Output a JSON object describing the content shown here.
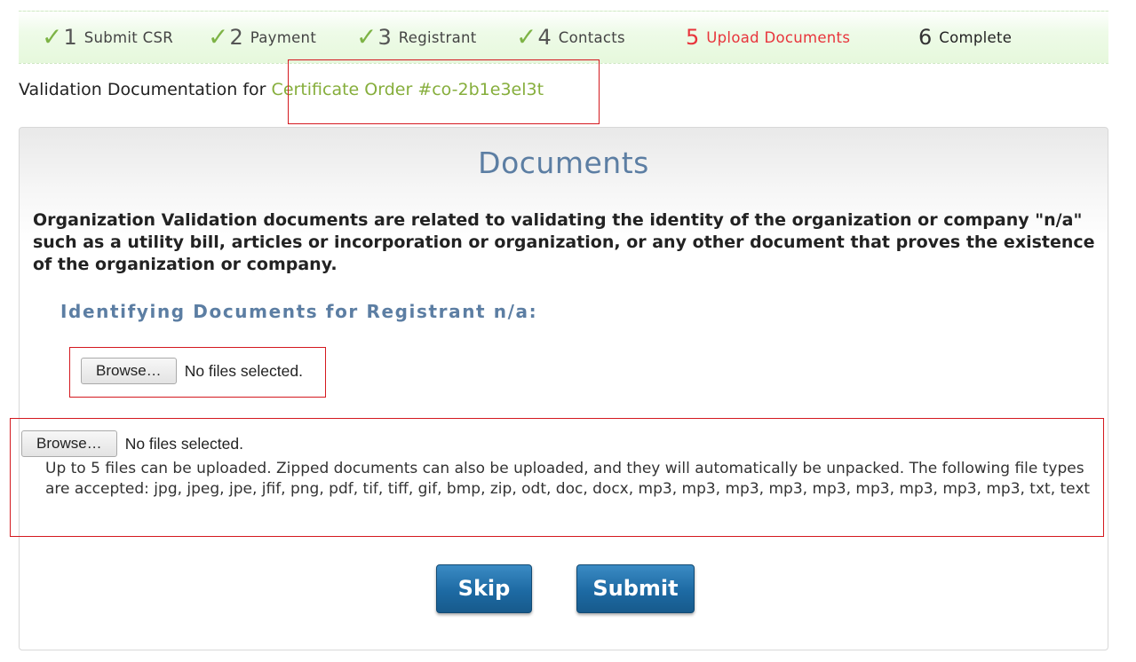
{
  "steps": [
    {
      "check": "✓",
      "num": "1",
      "label": "Submit CSR",
      "state": "done"
    },
    {
      "check": "✓",
      "num": "2",
      "label": "Payment",
      "state": "done"
    },
    {
      "check": "✓",
      "num": "3",
      "label": "Registrant",
      "state": "done"
    },
    {
      "check": "✓",
      "num": "4",
      "label": "Contacts",
      "state": "done"
    },
    {
      "check": "",
      "num": "5",
      "label": "Upload Documents",
      "state": "active"
    },
    {
      "check": "",
      "num": "6",
      "label": "Complete",
      "state": "pending"
    }
  ],
  "validation": {
    "prefix": "Validation Documentation for ",
    "order_link": "Certificate Order #co-2b1e3el3t"
  },
  "panel": {
    "title": "Documents",
    "description": "Organization Validation documents are related to validating the identity of the organization or company \"n/a\" such as a utility bill, articles or incorporation or organization, or any other document that proves the existence of the organization or company.",
    "registrant_heading": "Identifying Documents for Registrant n/a:"
  },
  "file_input_1": {
    "browse_label": "Browse…",
    "status": "No files selected."
  },
  "file_input_2": {
    "browse_label": "Browse…",
    "status": "No files selected."
  },
  "help_text": "Up to 5 files can be uploaded. Zipped documents can also be uploaded, and they will automatically be unpacked. The following file types are accepted: jpg, jpeg, jpe, jfif, png, pdf, tif, tiff, gif, bmp, zip, odt, doc, docx, mp3, mp3, mp3, mp3, mp3, mp3, mp3, mp3, mp3, txt, text",
  "buttons": {
    "skip": "Skip",
    "submit": "Submit"
  },
  "colors": {
    "check": "#7db345",
    "active_step": "#e8343b",
    "order_link": "#86ae3c",
    "heading": "#5c7ea3",
    "highlight_box": "#d4191f",
    "button": "#1d6aa3"
  }
}
